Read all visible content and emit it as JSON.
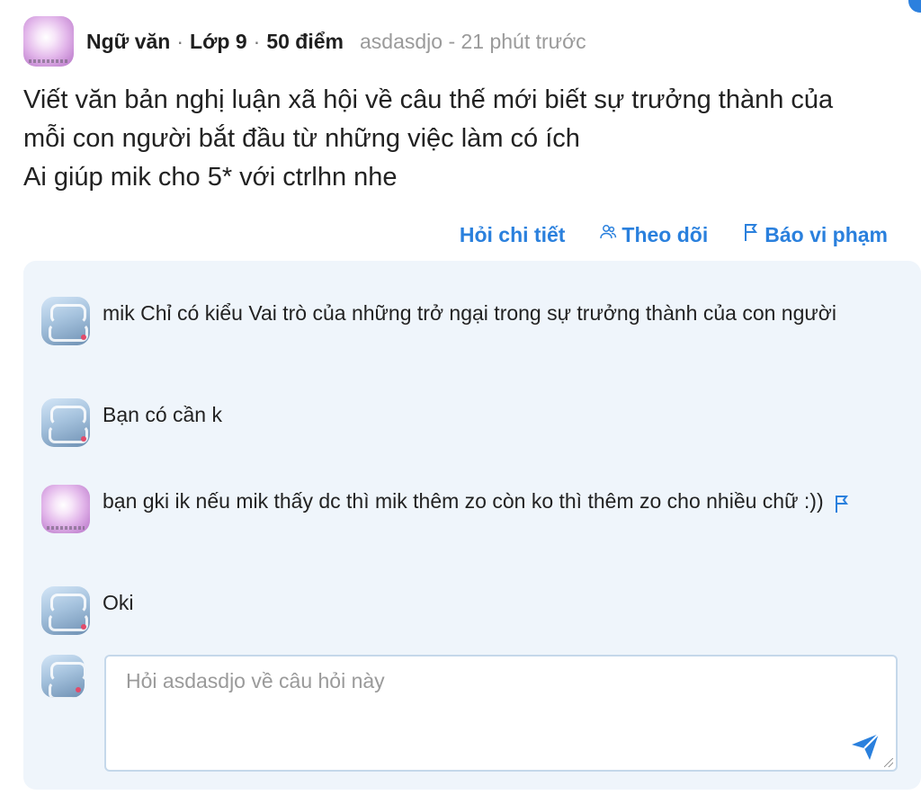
{
  "question": {
    "subject": "Ngữ văn",
    "grade": "Lớp 9",
    "points": "50 điểm",
    "author_time": "asdasdjo - 21 phút trước",
    "lines": [
      "Viết văn bản nghị luận xã hội về câu thế mới biết sự trưởng thành của",
      "mỗi con người bắt đầu từ những việc làm có ích",
      "Ai giúp mik cho 5* với ctrlhn nhe"
    ]
  },
  "actions": {
    "ask_detail": "Hỏi chi tiết",
    "follow": "Theo dõi",
    "report": "Báo vi phạm"
  },
  "comments": [
    {
      "text": "mik Chỉ có kiểu Vai trò của những trở ngại trong sự trưởng thành của con người"
    },
    {
      "text": "Bạn có cần k"
    },
    {
      "text": "bạn gki ik nếu mik thấy dc thì mik thêm zo còn ko thì thêm zo cho nhiều chữ :))"
    },
    {
      "text": "Oki"
    }
  ],
  "reply": {
    "placeholder": "Hỏi asdasdjo về câu hỏi này"
  },
  "icons": {
    "follow": "people-icon",
    "report": "flag-icon",
    "send": "send-icon"
  },
  "colors": {
    "accent": "#2a80dd",
    "panel_bg": "#eff5fb",
    "muted": "#9a9a9a"
  }
}
